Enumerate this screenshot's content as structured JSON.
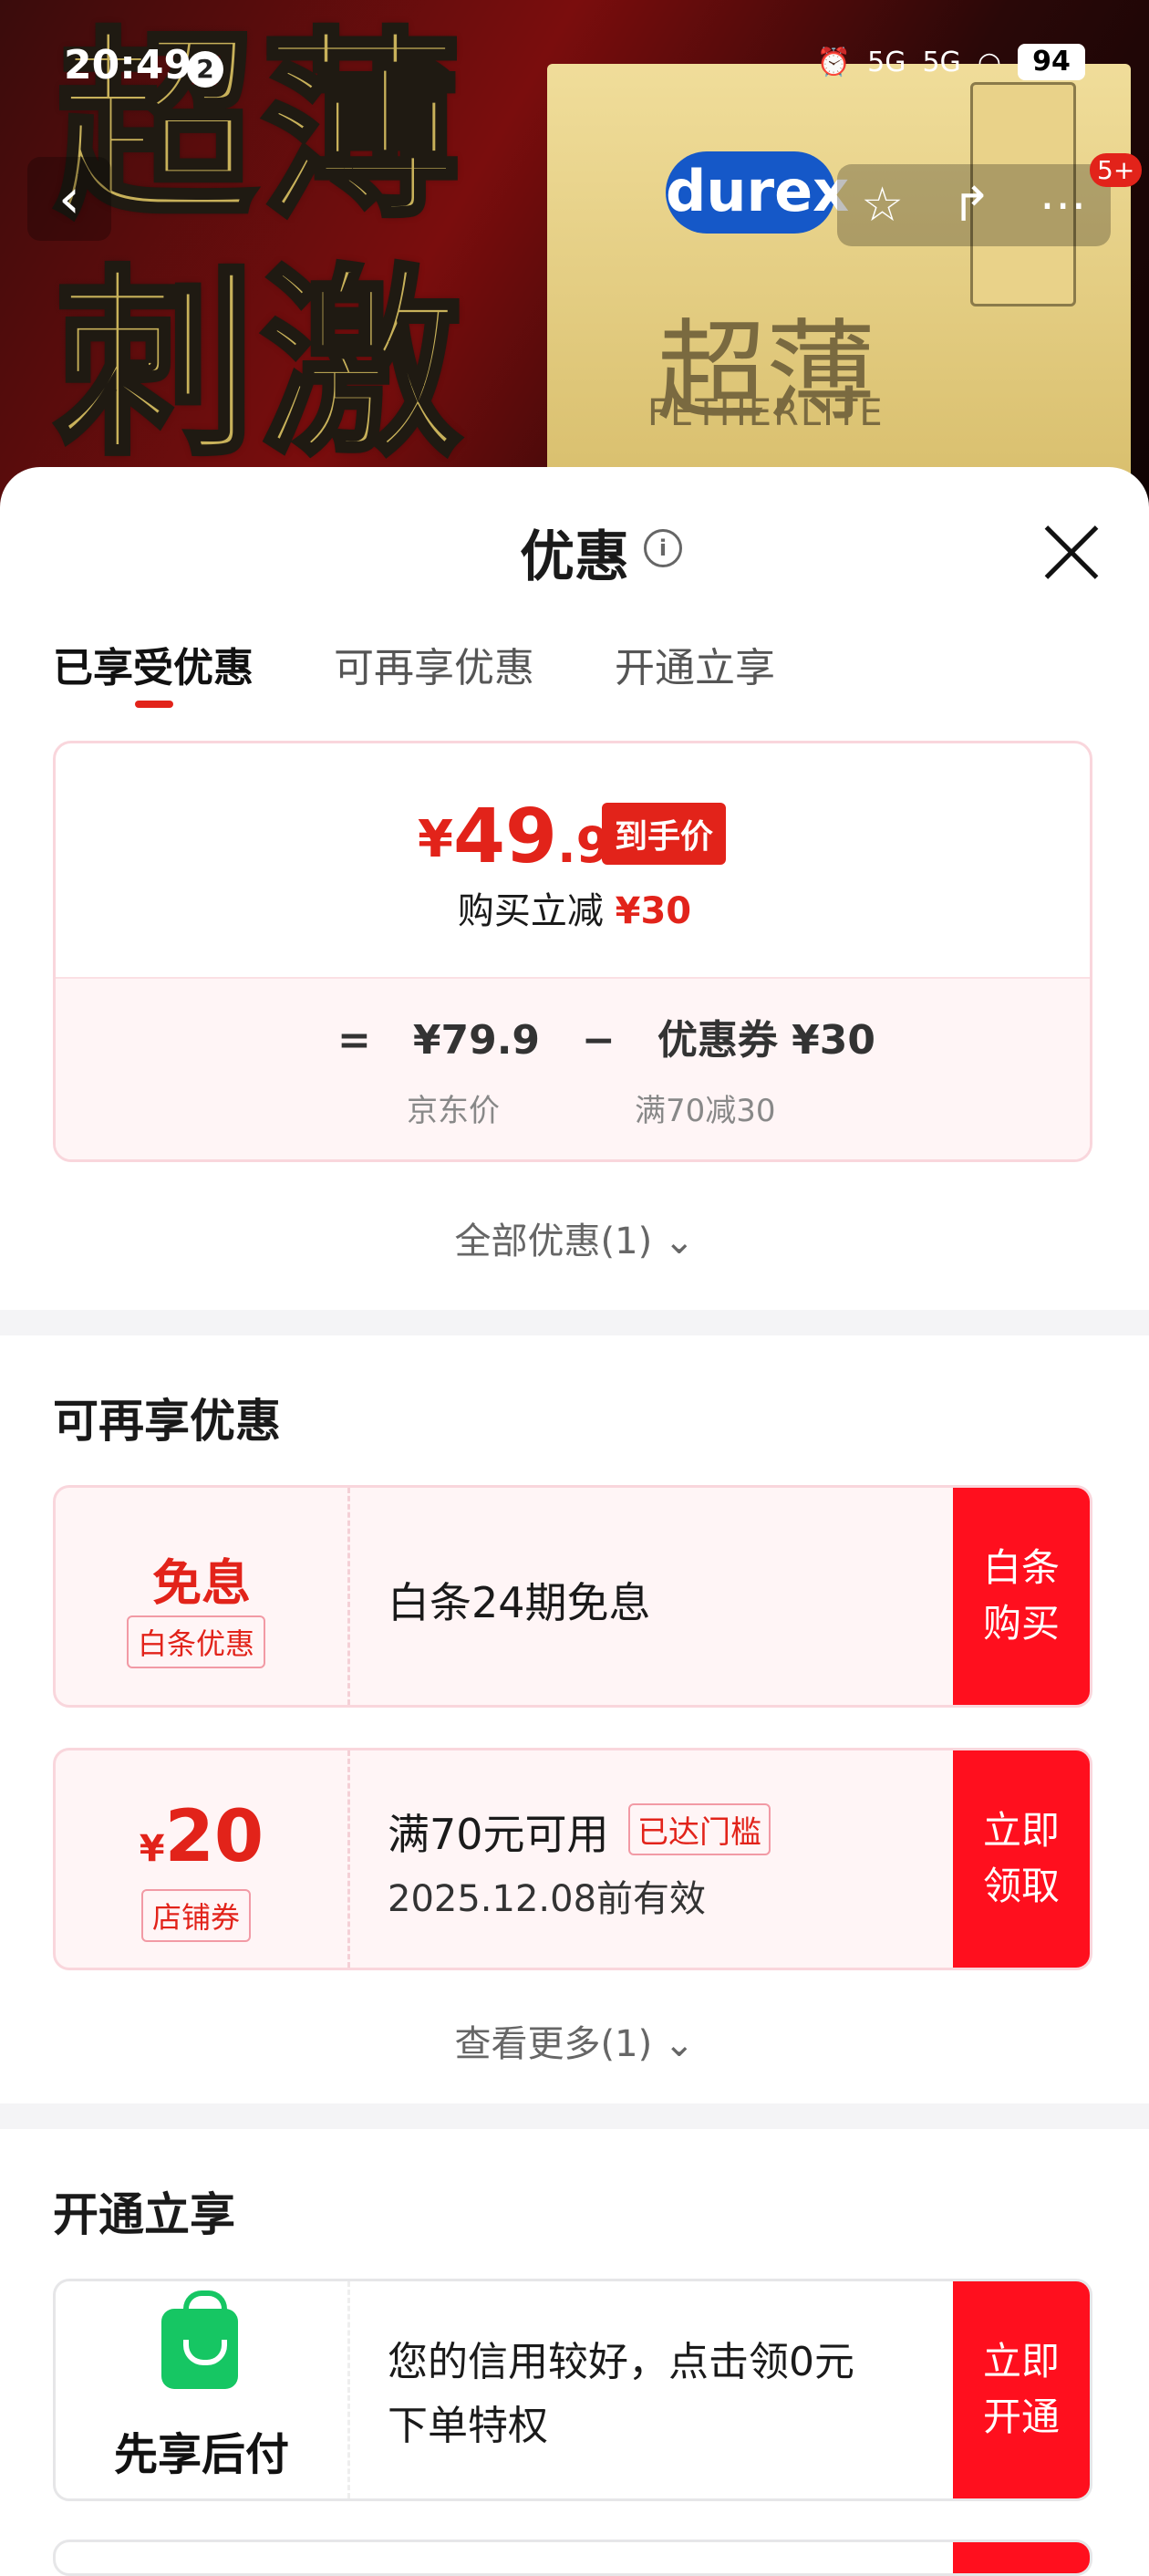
{
  "status_bar": {
    "time": "20:49",
    "notif_count": "2",
    "signal1": "5G",
    "signal2": "5G",
    "battery": "94"
  },
  "background": {
    "text_line1": "超薄",
    "text_line2": "刺激",
    "brand": "durex",
    "product_title": "超薄",
    "product_sub": "FETHERLITE"
  },
  "topbar": {
    "cart_badge": "5+"
  },
  "sheet": {
    "title": "优惠",
    "info": "i"
  },
  "tabs": [
    "已享受优惠",
    "可再享优惠",
    "开通立享"
  ],
  "price": {
    "currency": "¥",
    "integer": "49",
    "decimal": ".9",
    "tag": "到手价",
    "reduce_label": "购买立减",
    "reduce_value": "¥30"
  },
  "formula": {
    "eq": "=",
    "jd_price": "¥79.9",
    "minus": "−",
    "coupon": "优惠券 ¥30",
    "jd_label": "京东价",
    "coupon_rule": "满70减30"
  },
  "all_link": "全部优惠(1)",
  "section2_title": "可再享优惠",
  "coupon1": {
    "big": "免息",
    "tag": "白条优惠",
    "desc": "白条24期免息",
    "cta_line1": "白条",
    "cta_line2": "购买"
  },
  "coupon2": {
    "currency": "¥",
    "amount": "20",
    "tag": "店铺券",
    "desc": "满70元可用",
    "badge": "已达门槛",
    "expiry": "2025.12.08前有效",
    "cta_line1": "立即",
    "cta_line2": "领取"
  },
  "more_link": "查看更多(1)",
  "section3_title": "开通立享",
  "coupon3": {
    "label": "先享后付",
    "desc_line1": "您的信用较好，点击领0元",
    "desc_line2": "下单特权",
    "cta_line1": "立即",
    "cta_line2": "开通"
  }
}
